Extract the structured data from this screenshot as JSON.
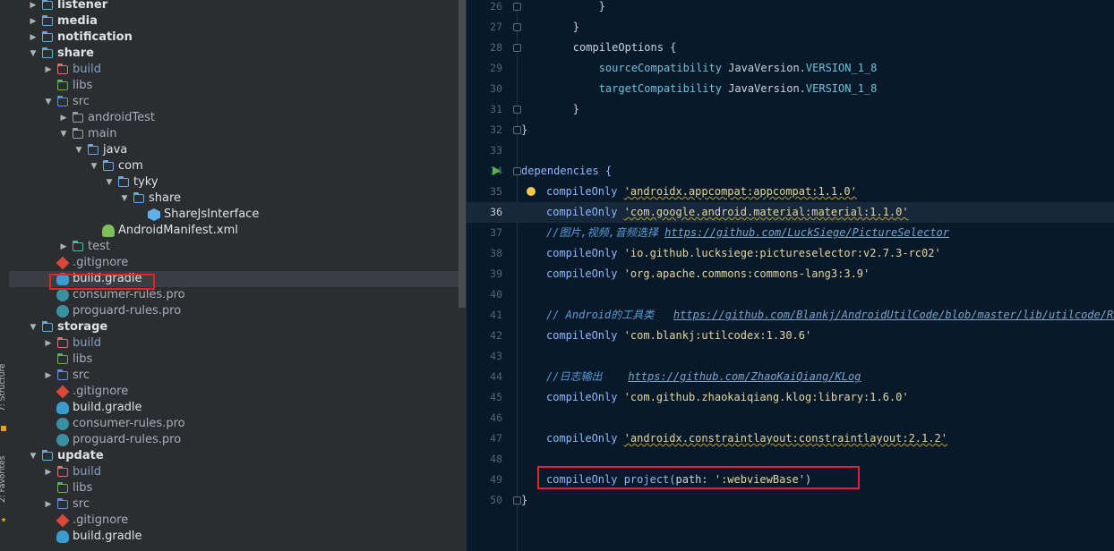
{
  "toolwindows": {
    "structure_label": "7: Structure",
    "favorites_label": "2: Favorites"
  },
  "tree": {
    "rows": [
      {
        "label": "listener",
        "type": "module",
        "expanded": false
      },
      {
        "label": "media",
        "type": "module",
        "expanded": false
      },
      {
        "label": "notification",
        "type": "module",
        "expanded": false
      },
      {
        "label": "share",
        "type": "module",
        "expanded": true
      },
      {
        "label": "build",
        "type": "folder-build",
        "expanded": false
      },
      {
        "label": "libs",
        "type": "folder-libs"
      },
      {
        "label": "src",
        "type": "folder-src",
        "expanded": true
      },
      {
        "label": "androidTest",
        "type": "folder-gray",
        "expanded": false
      },
      {
        "label": "main",
        "type": "folder-gray",
        "expanded": true
      },
      {
        "label": "java",
        "type": "folder-blue",
        "expanded": true
      },
      {
        "label": "com",
        "type": "folder-blue",
        "expanded": true
      },
      {
        "label": "tyky",
        "type": "folder-blue",
        "expanded": true
      },
      {
        "label": "share",
        "type": "folder-blue",
        "expanded": true
      },
      {
        "label": "ShareJsInterface",
        "type": "file-java"
      },
      {
        "label": "AndroidManifest.xml",
        "type": "file-android"
      },
      {
        "label": "test",
        "type": "folder-test",
        "expanded": false
      },
      {
        "label": ".gitignore",
        "type": "file-git"
      },
      {
        "label": "build.gradle",
        "type": "file-gradle",
        "selected": true
      },
      {
        "label": "consumer-rules.pro",
        "type": "file-pro"
      },
      {
        "label": "proguard-rules.pro",
        "type": "file-pro"
      },
      {
        "label": "storage",
        "type": "module",
        "expanded": true
      },
      {
        "label": "build",
        "type": "folder-build",
        "expanded": false
      },
      {
        "label": "libs",
        "type": "folder-libs"
      },
      {
        "label": "src",
        "type": "folder-src",
        "expanded": false
      },
      {
        "label": ".gitignore",
        "type": "file-git"
      },
      {
        "label": "build.gradle",
        "type": "file-gradle"
      },
      {
        "label": "consumer-rules.pro",
        "type": "file-pro"
      },
      {
        "label": "proguard-rules.pro",
        "type": "file-pro"
      },
      {
        "label": "update",
        "type": "module",
        "expanded": true
      },
      {
        "label": "build",
        "type": "folder-build",
        "expanded": false
      },
      {
        "label": "libs",
        "type": "folder-libs"
      },
      {
        "label": "src",
        "type": "folder-src",
        "expanded": false
      },
      {
        "label": ".gitignore",
        "type": "file-git"
      },
      {
        "label": "build.gradle",
        "type": "file-gradle"
      }
    ]
  },
  "editor": {
    "current_line": "36",
    "lines": [
      {
        "n": "26",
        "segs": [
          {
            "t": "            }",
            "c": ""
          }
        ]
      },
      {
        "n": "27",
        "segs": [
          {
            "t": "        }",
            "c": ""
          }
        ]
      },
      {
        "n": "28",
        "segs": [
          {
            "t": "        compileOptions {",
            "c": ""
          }
        ]
      },
      {
        "n": "29",
        "segs": [
          {
            "t": "            ",
            "c": ""
          },
          {
            "t": "sourceCompatibility",
            "c": "prop"
          },
          {
            "t": " JavaVersion.",
            "c": ""
          },
          {
            "t": "VERSION_1_8",
            "c": "prop"
          }
        ]
      },
      {
        "n": "30",
        "segs": [
          {
            "t": "            ",
            "c": ""
          },
          {
            "t": "targetCompatibility",
            "c": "prop"
          },
          {
            "t": " JavaVersion.",
            "c": ""
          },
          {
            "t": "VERSION_1_8",
            "c": "prop"
          }
        ]
      },
      {
        "n": "31",
        "segs": [
          {
            "t": "        }",
            "c": ""
          }
        ]
      },
      {
        "n": "32",
        "segs": [
          {
            "t": "}",
            "c": ""
          }
        ]
      },
      {
        "n": "33",
        "segs": []
      },
      {
        "n": "34",
        "segs": [
          {
            "t": "dependencies {",
            "c": "kw"
          }
        ]
      },
      {
        "n": "35",
        "segs": [
          {
            "t": "compileOnly ",
            "c": "kw"
          },
          {
            "t": "'androidx.appcompat:appcompat:1.1.0'",
            "c": "str und"
          }
        ]
      },
      {
        "n": "36",
        "segs": [
          {
            "t": "compileOnly ",
            "c": "kw"
          },
          {
            "t": "'com.google.android.material:material:1.1.0'",
            "c": "str und"
          }
        ]
      },
      {
        "n": "37",
        "segs": [
          {
            "t": "//图片,视频,音频选择 ",
            "c": "cmt"
          },
          {
            "t": "https://github.com/LuckSiege/PictureSelector",
            "c": "url"
          }
        ]
      },
      {
        "n": "38",
        "segs": [
          {
            "t": "compileOnly ",
            "c": "kw"
          },
          {
            "t": "'io.github.lucksiege:pictureselector:v2.7.3-rc02'",
            "c": "str"
          }
        ]
      },
      {
        "n": "39",
        "segs": [
          {
            "t": "compileOnly ",
            "c": "kw"
          },
          {
            "t": "'org.apache.commons:commons-lang3:3.9'",
            "c": "str"
          }
        ]
      },
      {
        "n": "40",
        "segs": []
      },
      {
        "n": "41",
        "segs": [
          {
            "t": "// Android的工具类   ",
            "c": "cmt"
          },
          {
            "t": "https://github.com/Blankj/AndroidUtilCode/blob/master/lib/utilcode/READ",
            "c": "url"
          }
        ]
      },
      {
        "n": "42",
        "segs": [
          {
            "t": "compileOnly ",
            "c": "kw"
          },
          {
            "t": "'com.blankj:utilcodex:1.30.6'",
            "c": "str"
          }
        ]
      },
      {
        "n": "43",
        "segs": []
      },
      {
        "n": "44",
        "segs": [
          {
            "t": "//日志输出    ",
            "c": "cmt"
          },
          {
            "t": "https://github.com/ZhaoKaiQiang/KLog",
            "c": "url"
          }
        ]
      },
      {
        "n": "45",
        "segs": [
          {
            "t": "compileOnly ",
            "c": "kw"
          },
          {
            "t": "'com.github.zhaokaiqiang.klog:library:1.6.0'",
            "c": "str"
          }
        ]
      },
      {
        "n": "46",
        "segs": []
      },
      {
        "n": "47",
        "segs": [
          {
            "t": "compileOnly ",
            "c": "kw"
          },
          {
            "t": "'androidx.constraintlayout:constraintlayout:2.1.2'",
            "c": "str und"
          }
        ]
      },
      {
        "n": "48",
        "segs": []
      },
      {
        "n": "49",
        "segs": [
          {
            "t": "compileOnly ",
            "c": "kw"
          },
          {
            "t": "project(",
            "c": "kw"
          },
          {
            "t": "path: ",
            "c": ""
          },
          {
            "t": "':webviewBase'",
            "c": "str"
          },
          {
            "t": ")",
            "c": ""
          }
        ]
      },
      {
        "n": "50",
        "segs": [
          {
            "t": "}",
            "c": ""
          }
        ]
      }
    ]
  },
  "colors": {
    "module": "#5fb0d8",
    "folder_blue": "#6aa7e8",
    "folder_gray": "#9aa0a8",
    "build": "#e06c75",
    "libs": "#62b543",
    "src": "#5d8fe0",
    "test": "#3fc0a0",
    "git": "#d8473a",
    "gradle": "#3a9bd1",
    "pro": "#3a8fa0",
    "android": "#7cc05a",
    "java_file": "#5fb0e8"
  }
}
